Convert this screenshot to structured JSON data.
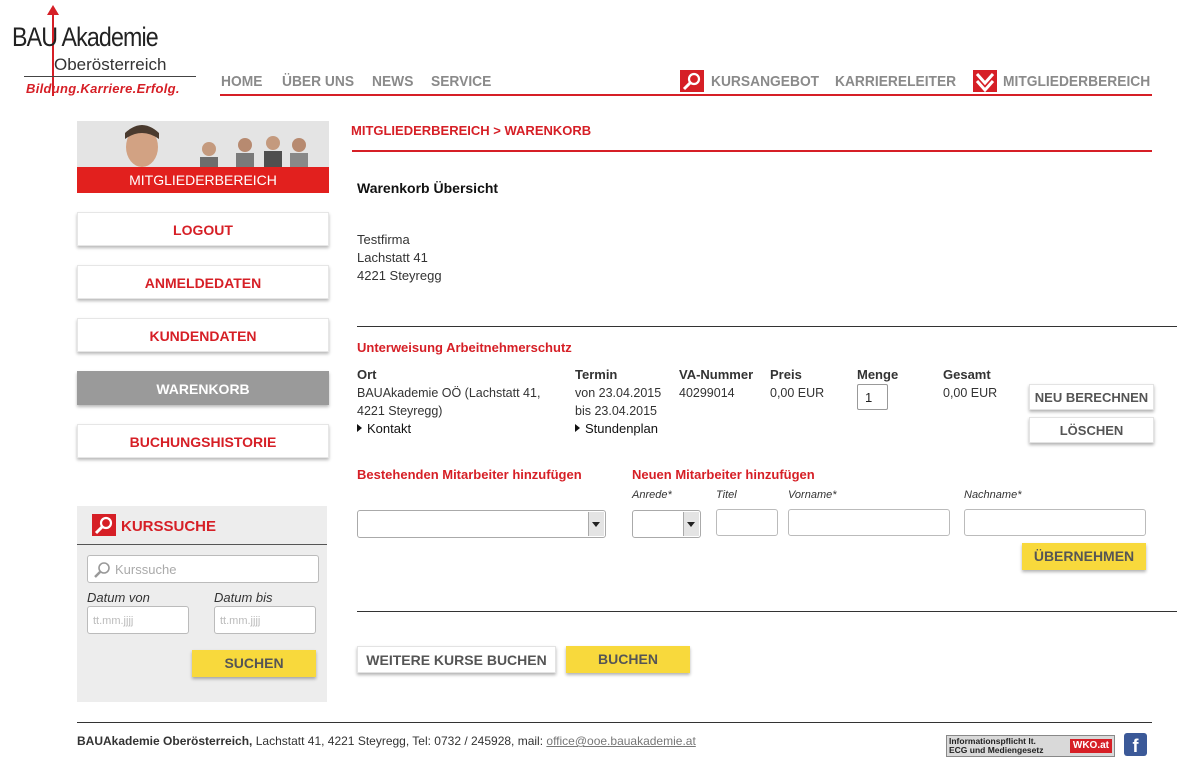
{
  "brand": {
    "logo_line1": "BAU Akademie",
    "logo_line2": "Oberösterreich",
    "claim": "Bildung.Karriere.Erfolg."
  },
  "nav": {
    "home": "HOME",
    "about": "ÜBER UNS",
    "news": "NEWS",
    "service": "SERVICE",
    "courses": "KURSANGEBOT",
    "career": "KARRIERELEITER",
    "members": "MITGLIEDERBEREICH"
  },
  "sidebar": {
    "hero_label": "MITGLIEDERBEREICH",
    "items": [
      {
        "label": "LOGOUT"
      },
      {
        "label": "ANMELDEDATEN"
      },
      {
        "label": "KUNDENDATEN"
      },
      {
        "label": "WARENKORB"
      },
      {
        "label": "BUCHUNGSHISTORIE"
      }
    ],
    "search": {
      "title": "KURSSUCHE",
      "placeholder": "Kurssuche",
      "date_from_label": "Datum von",
      "date_to_label": "Datum bis",
      "date_placeholder": "tt.mm.jjjj",
      "button": "SUCHEN"
    }
  },
  "main": {
    "breadcrumb": "MITGLIEDERBEREICH > WARENKORB",
    "title": "Warenkorb Übersicht",
    "address": {
      "company": "Testfirma",
      "street": "Lachstatt 41",
      "city": "4221 Steyregg"
    },
    "course": {
      "name": "Unterweisung Arbeitnehmerschutz",
      "columns": {
        "ort": "Ort",
        "termin": "Termin",
        "va": "VA-Nummer",
        "preis": "Preis",
        "menge": "Menge",
        "gesamt": "Gesamt"
      },
      "ort_line1": "BAUAkademie OÖ (Lachstatt 41,",
      "ort_line2": "4221 Steyregg)",
      "termin_line1": "von 23.04.2015",
      "termin_line2": "bis 23.04.2015",
      "va_nummer": "40299014",
      "preis": "0,00 EUR",
      "menge": "1",
      "gesamt": "0,00 EUR",
      "link_contact": "Kontakt",
      "link_schedule": "Stundenplan",
      "btn_recalc": "NEU BERECHNEN",
      "btn_delete": "LÖSCHEN"
    },
    "employees": {
      "existing_title": "Bestehenden Mitarbeiter hinzufügen",
      "new_title": "Neuen Mitarbeiter hinzufügen",
      "label_salutation": "Anrede*",
      "label_title": "Titel",
      "label_firstname": "Vorname*",
      "label_lastname": "Nachname*",
      "btn_apply": "ÜBERNEHMEN"
    },
    "btn_more": "WEITERE KURSE BUCHEN",
    "btn_book": "BUCHEN"
  },
  "footer": {
    "org": "BAUAkademie Oberösterreich,",
    "details": " Lachstatt 41, 4221 Steyregg, Tel: 0732 / 245928, mail: ",
    "mail": "office@ooe.bauakademie.at",
    "wko_line1": "Informationspflicht lt.",
    "wko_line2": "ECG und Mediengesetz",
    "wko_logo": "WKO.at",
    "facebook": "f"
  },
  "colors": {
    "accent": "#d61f26",
    "button_yellow": "#f8d93c",
    "active_gray": "#9a9a9a"
  }
}
